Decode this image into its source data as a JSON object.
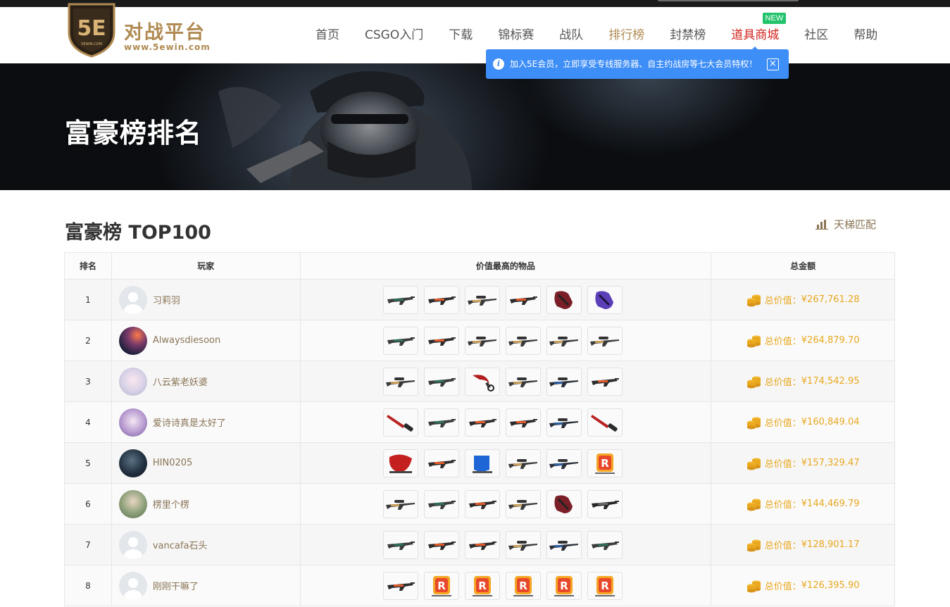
{
  "brand": {
    "logo_letters": "5E",
    "logo_small": "5EWIN.COM",
    "title": "对战平台",
    "url": "www.5ewin.com"
  },
  "nav": [
    {
      "label": "首页",
      "state": "normal"
    },
    {
      "label": "CSGO入门",
      "state": "normal"
    },
    {
      "label": "下载",
      "state": "normal"
    },
    {
      "label": "锦标赛",
      "state": "normal"
    },
    {
      "label": "战队",
      "state": "normal"
    },
    {
      "label": "排行榜",
      "state": "active"
    },
    {
      "label": "封禁榜",
      "state": "normal"
    },
    {
      "label": "道具商城",
      "state": "shop",
      "badge": "NEW"
    },
    {
      "label": "社区",
      "state": "normal"
    },
    {
      "label": "帮助",
      "state": "normal"
    }
  ],
  "tooltip": {
    "text": "加入5E会员，立即享受专线服务器、自主约战房等七大会员特权！",
    "close": "×"
  },
  "banner": {
    "title": "富豪榜排名"
  },
  "section": {
    "title": "富豪榜 TOP100",
    "ladder_link": "天梯匹配"
  },
  "table": {
    "headers": {
      "rank": "排名",
      "player": "玩家",
      "items": "价值最高的物品",
      "total": "总金额"
    },
    "total_prefix": "总价值：",
    "rows": [
      {
        "rank": "1",
        "name": "习莉羽",
        "avatar": "default",
        "total": "¥267,761.28",
        "items": [
          "ak-green",
          "m4-orange",
          "awp-gold",
          "m4-orange",
          "gloves-red",
          "gloves-purple"
        ]
      },
      {
        "rank": "2",
        "name": "Alwaysdiesoon",
        "avatar": "photo-night",
        "total": "¥264,879.70",
        "items": [
          "ak-green",
          "m4-orange",
          "awp-gold",
          "awp-gold",
          "awp-gold",
          "awp-gold"
        ]
      },
      {
        "rank": "3",
        "name": "八云紫老妖婆",
        "avatar": "anime-white",
        "total": "¥174,542.95",
        "items": [
          "awp-gold",
          "ak-green",
          "karambit-red",
          "awp-gold",
          "awp-blue",
          "m4-orange"
        ]
      },
      {
        "rank": "4",
        "name": "爱诗诗真是太好了",
        "avatar": "anime-purple",
        "total": "¥160,849.04",
        "items": [
          "bayonet-red",
          "ak-green",
          "m4-orange",
          "m4-orange",
          "awp-blue",
          "bayonet-red"
        ]
      },
      {
        "rank": "5",
        "name": "HIN0205",
        "avatar": "photo-dark",
        "total": "¥157,329.47",
        "items": [
          "sticker-red",
          "m4-orange",
          "sticker-blue",
          "awp-gold",
          "awp-blue",
          "sticker-r"
        ]
      },
      {
        "rank": "6",
        "name": "楞里个楞",
        "avatar": "photo-girl",
        "total": "¥144,469.79",
        "items": [
          "awp-gold",
          "ak-green",
          "m4-orange",
          "awp-gold",
          "gloves-red",
          "m4-dark"
        ]
      },
      {
        "rank": "7",
        "name": "vancafa石头",
        "avatar": "default",
        "total": "¥128,901.17",
        "items": [
          "ak-green",
          "m4-orange",
          "m4-orange",
          "awp-gold",
          "awp-blue",
          "ak-green"
        ]
      },
      {
        "rank": "8",
        "name": "刚刚干嘛了",
        "avatar": "default",
        "total": "¥126,395.90",
        "items": [
          "m4-orange",
          "sticker-r",
          "sticker-r",
          "sticker-r",
          "sticker-r",
          "sticker-r"
        ]
      }
    ]
  },
  "colors": {
    "brand_gold": "#b08a52",
    "shop_red": "#d2221d",
    "badge_green": "#22c36b",
    "tooltip_blue": "#3e8ef7",
    "name_brown": "#8a7556",
    "total_orange": "#e9a81f"
  },
  "icons": {
    "info": "info-icon",
    "close": "close-icon",
    "ladder": "bar-chart-icon",
    "coin": "coin-stack-icon"
  }
}
